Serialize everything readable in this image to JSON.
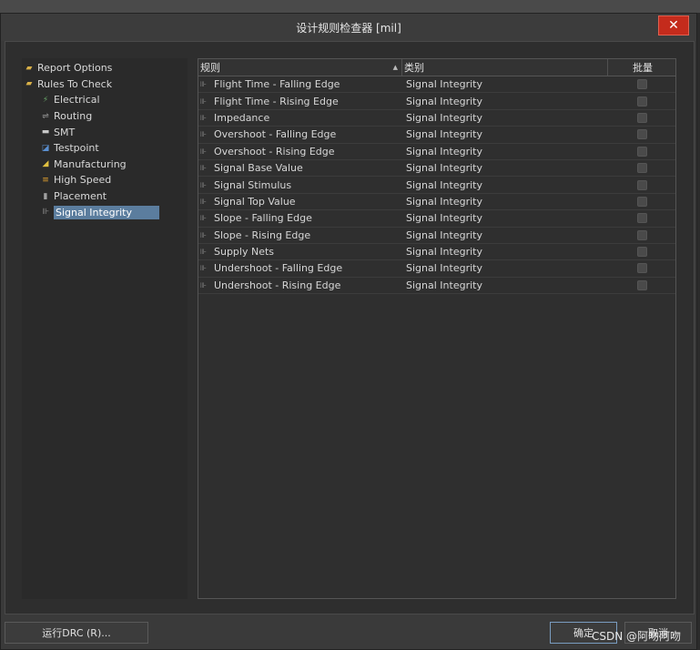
{
  "dialog": {
    "title": "设计规则检查器 [mil]",
    "close_label": "✕"
  },
  "tree": {
    "items": [
      {
        "label": "Report Options",
        "icon": "folder-icon",
        "level": 0
      },
      {
        "label": "Rules To Check",
        "icon": "folder-icon",
        "level": 0
      },
      {
        "label": "Electrical",
        "icon": "electrical-icon",
        "level": 1
      },
      {
        "label": "Routing",
        "icon": "routing-icon",
        "level": 1
      },
      {
        "label": "SMT",
        "icon": "smt-icon",
        "level": 1
      },
      {
        "label": "Testpoint",
        "icon": "testpoint-icon",
        "level": 1
      },
      {
        "label": "Manufacturing",
        "icon": "manufacturing-icon",
        "level": 1
      },
      {
        "label": "High Speed",
        "icon": "high-speed-icon",
        "level": 1
      },
      {
        "label": "Placement",
        "icon": "placement-icon",
        "level": 1
      },
      {
        "label": "Signal Integrity",
        "icon": "signal-integrity-icon",
        "level": 1,
        "selected": true
      }
    ]
  },
  "grid": {
    "columns": [
      "规则",
      "类别",
      "批量"
    ],
    "rows": [
      {
        "rule": "Flight Time - Falling Edge",
        "category": "Signal Integrity",
        "batch": false
      },
      {
        "rule": "Flight Time - Rising Edge",
        "category": "Signal Integrity",
        "batch": false
      },
      {
        "rule": "Impedance",
        "category": "Signal Integrity",
        "batch": false
      },
      {
        "rule": "Overshoot - Falling Edge",
        "category": "Signal Integrity",
        "batch": false
      },
      {
        "rule": "Overshoot - Rising Edge",
        "category": "Signal Integrity",
        "batch": false
      },
      {
        "rule": "Signal Base Value",
        "category": "Signal Integrity",
        "batch": false
      },
      {
        "rule": "Signal Stimulus",
        "category": "Signal Integrity",
        "batch": false
      },
      {
        "rule": "Signal Top Value",
        "category": "Signal Integrity",
        "batch": false
      },
      {
        "rule": "Slope - Falling Edge",
        "category": "Signal Integrity",
        "batch": false
      },
      {
        "rule": "Slope - Rising Edge",
        "category": "Signal Integrity",
        "batch": false
      },
      {
        "rule": "Supply Nets",
        "category": "Signal Integrity",
        "batch": false
      },
      {
        "rule": "Undershoot - Falling Edge",
        "category": "Signal Integrity",
        "batch": false
      },
      {
        "rule": "Undershoot - Rising Edge",
        "category": "Signal Integrity",
        "batch": false
      }
    ]
  },
  "footer": {
    "run_label": "运行DRC (R)...",
    "ok_label": "确定",
    "cancel_label": "取消"
  },
  "watermark": "CSDN @阿吻阿吻",
  "colors": {
    "accent_selected": "#5b7d9e",
    "close_red": "#c42b1c"
  }
}
